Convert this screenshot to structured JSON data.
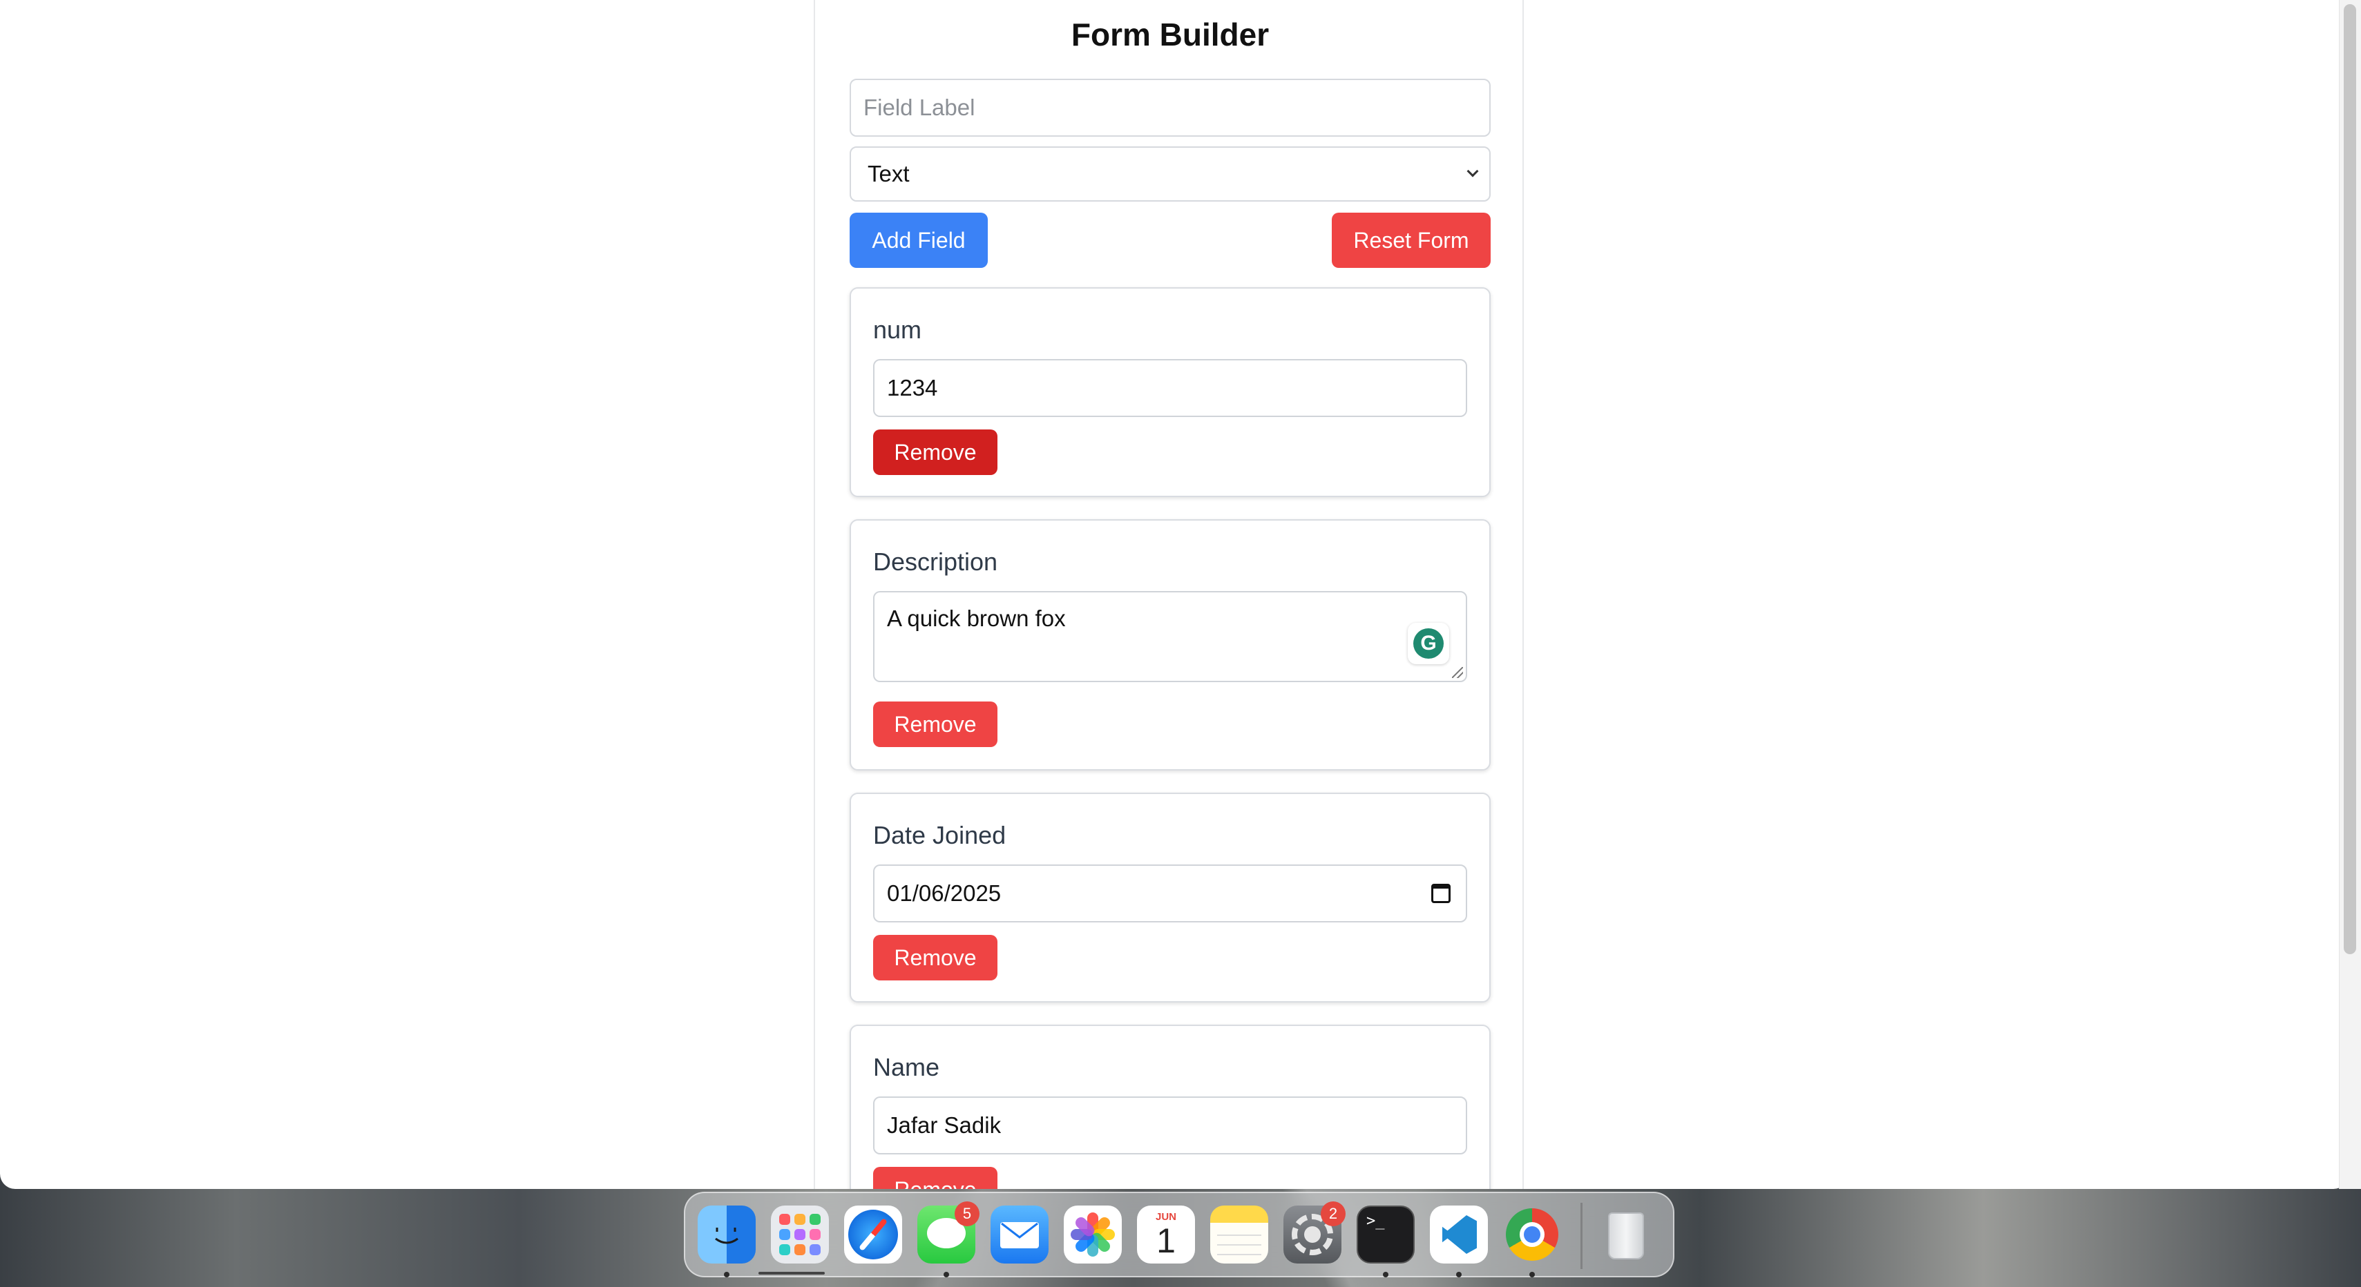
{
  "form_builder": {
    "title": "Form Builder",
    "label_input": {
      "value": "",
      "placeholder": "Field Label"
    },
    "type_select": {
      "selected": "Text"
    },
    "add_field_label": "Add Field",
    "reset_form_label": "Reset Form"
  },
  "fields": [
    {
      "label": "num",
      "type": "number",
      "value": "1234",
      "remove_label": "Remove"
    },
    {
      "label": "Description",
      "type": "textarea",
      "value": "A quick brown fox",
      "remove_label": "Remove"
    },
    {
      "label": "Date Joined",
      "type": "date",
      "value": "01/06/2025",
      "remove_label": "Remove"
    },
    {
      "label": "Name",
      "type": "text",
      "value": "Jafar Sadik",
      "remove_label": "Remove"
    }
  ],
  "dock": {
    "apps": [
      {
        "name": "Finder",
        "icon": "finder-icon",
        "running": true
      },
      {
        "name": "Launchpad",
        "icon": "launchpad-icon",
        "running": false
      },
      {
        "name": "Safari",
        "icon": "safari-icon",
        "running": false
      },
      {
        "name": "Messages",
        "icon": "messages-icon",
        "running": true,
        "badge": "5"
      },
      {
        "name": "Mail",
        "icon": "mail-icon",
        "running": false
      },
      {
        "name": "Photos",
        "icon": "photos-icon",
        "running": false
      },
      {
        "name": "Calendar",
        "icon": "calendar-icon",
        "running": false,
        "month": "JUN",
        "day": "1"
      },
      {
        "name": "Notes",
        "icon": "notes-icon",
        "running": false
      },
      {
        "name": "System Settings",
        "icon": "settings-icon",
        "running": false,
        "badge": "2"
      },
      {
        "name": "Terminal",
        "icon": "terminal-icon",
        "running": true
      },
      {
        "name": "Visual Studio Code",
        "icon": "vscode-icon",
        "running": true
      },
      {
        "name": "Google Chrome",
        "icon": "chrome-icon",
        "running": true
      },
      {
        "name": "Trash",
        "icon": "trash-icon",
        "running": false
      }
    ]
  },
  "colors": {
    "primary": "#3b82f6",
    "danger": "#ef4444",
    "danger_active": "#d1201f"
  }
}
